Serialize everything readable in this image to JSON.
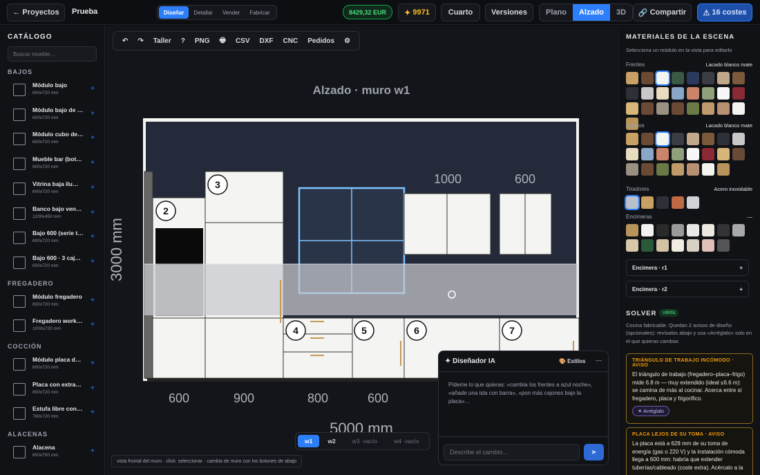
{
  "topbar": {
    "back": "← Proyectos",
    "project": "Prueba",
    "modes": [
      "Diseñar",
      "Detallar",
      "Vender",
      "Fabricar"
    ],
    "price": "8429,32 EUR",
    "credits": "9971",
    "room": "Cuarto",
    "versions": "Versiones",
    "views": [
      "Plano",
      "Alzado",
      "3D"
    ],
    "share": "Compartir",
    "costs": "16 costes"
  },
  "catalog": {
    "title": "CATÁLOGO",
    "search_placeholder": "Buscar mueble…",
    "groups": [
      {
        "name": "BAJOS",
        "items": [
          {
            "name": "Módulo bajo",
            "size": "600x720 mm"
          },
          {
            "name": "Módulo bajo de …",
            "size": "600x720 mm"
          },
          {
            "name": "Módulo cubo de…",
            "size": "600x720 mm"
          },
          {
            "name": "Mueble bar (bot…",
            "size": "600x720 mm"
          },
          {
            "name": "Vitrina baja ilu…",
            "size": "600x720 mm"
          },
          {
            "name": "Banco bajo ven…",
            "size": "1200x450 mm"
          },
          {
            "name": "Bajo 600 (serie t…",
            "size": "600x720 mm"
          },
          {
            "name": "Bajo 600 · 3 caj…",
            "size": "600x720 mm"
          }
        ]
      },
      {
        "name": "FREGADERO",
        "items": [
          {
            "name": "Módulo fregadero",
            "size": "800x720 mm"
          },
          {
            "name": "Fregadero work…",
            "size": "1000x720 mm"
          }
        ]
      },
      {
        "name": "COCCIÓN",
        "items": [
          {
            "name": "Módulo placa d…",
            "size": "600x720 mm"
          },
          {
            "name": "Placa con extra…",
            "size": "800x720 mm"
          },
          {
            "name": "Estufa libre con…",
            "size": "760x720 mm"
          }
        ]
      },
      {
        "name": "ALACENAS",
        "items": [
          {
            "name": "Alacena",
            "size": "600x700 mm"
          }
        ]
      }
    ]
  },
  "toolbar": [
    "↶",
    "↷",
    "Taller",
    "?",
    "PNG",
    "🖶",
    "CSV",
    "DXF",
    "CNC",
    "Pedidos",
    "⚙"
  ],
  "canvas": {
    "title": "Alzado · muro w1",
    "height_label": "3000 mm",
    "width_label": "5000 mm",
    "top_dims": [
      "1000",
      "600"
    ],
    "bottom_dims": [
      "600",
      "900",
      "800",
      "600"
    ],
    "markers": [
      "2",
      "3",
      "4",
      "5",
      "6",
      "7"
    ]
  },
  "walls": [
    {
      "label": "w1"
    },
    {
      "label": "w2"
    },
    {
      "label": "w3 ·vacío"
    },
    {
      "label": "w4 ·vacío"
    }
  ],
  "hint": "vista frontal del muro · click: seleccionar · cambia de muro con los botones de abajo",
  "ai": {
    "title": "✦ Diseñador IA",
    "styles": "🎨 Estilos",
    "minimize": "—",
    "intro": "Pídeme lo que quieras: «cambia los frentes a azul noche», «añade una isla con barra», «pon más cajones bajo la placa»…",
    "placeholder": "Describe el cambio…",
    "send": "➤"
  },
  "materials": {
    "title": "MATERIALES DE LA ESCENA",
    "hint": "Selecciona un módulo en la vista para editarlo",
    "frentes": {
      "label": "Frentes",
      "value": "Lacado blanco mate",
      "colors": [
        "#c9a063",
        "#6a4a35",
        "#f4f4f2",
        "#3a5a45",
        "#2b3a5c",
        "#3a3d42",
        "#c2a88a",
        "#7a5a3a",
        "#2d3038",
        "#c8c8c8",
        "#e8dcc0",
        "#8aa6c6",
        "#c9846a",
        "#8fa07a",
        "#f7f7f7",
        "#8a2a35",
        "#d8b67a",
        "#6a4a35",
        "#9a9182",
        "#6b4a35",
        "#6b7a45",
        "#c19a6b",
        "#b89072",
        "#f4f4f0",
        "#b8945a"
      ]
    },
    "cascos": {
      "label": "Cascos",
      "value": "Lacado blanco mate",
      "colors": [
        "#c9a063",
        "#6a4a35",
        "#f4f4f2",
        "#3a3d42",
        "#c2a88a",
        "#7a5a3a",
        "#2d3038",
        "#c8c8c8",
        "#e8dcc0",
        "#8aa6c6",
        "#c9846a",
        "#8fa07a",
        "#f7f7f7",
        "#8a2a35",
        "#d8b67a",
        "#6a4a35",
        "#9a9182",
        "#6b4a35",
        "#6b7a45",
        "#c19a6b",
        "#b89072",
        "#f4f4f0",
        "#b8945a"
      ]
    },
    "tiradores": {
      "label": "Tiradores",
      "value": "Acero inoxidable",
      "colors": [
        "#b8c0cc",
        "#c9a063",
        "#2d3038",
        "#c06a45",
        "#cfd3d8"
      ]
    },
    "encimeras": {
      "label": "Encimeras",
      "value": "—",
      "colors": [
        "#b8945a",
        "#f2f2f0",
        "#2a2a2a",
        "#9a9a9a",
        "#e8e8e6",
        "#ede9e1",
        "#333336",
        "#a8a8aa",
        "#d8c8a8",
        "#2a5a3a",
        "#d4c2a4",
        "#f0ece2",
        "#d8d0c2",
        "#e0c0b8",
        "#555558"
      ]
    },
    "rows": [
      {
        "label": "Encimera · r1"
      },
      {
        "label": "Encimera · r2"
      }
    ]
  },
  "solver": {
    "title": "SOLVER",
    "badge": "válida",
    "text": "Cocina fabricable. Quedan 2 avisos de diseño (opcionales): revísalos abajo y usa «Arréglalo» solo en el que quieras cambiar.",
    "warnings": [
      {
        "title": "TRIÁNGULO DE TRABAJO INCÓMODO · AVISO",
        "body": "El triángulo de trabajo (fregadero–placa–frigo) mide 6.8 m — muy extendido (ideal ≤6.6 m): se camina de más al cocinar. Acerca entre sí fregadero, placa y frigorífico.",
        "fix": "✦ Arréglalo"
      },
      {
        "title": "PLACA LEJOS DE SU TOMA · AVISO",
        "body": "La placa está a 628 mm de su toma de energía (gas o 220 V) y la instalación cómoda llega a 600 mm: habría que extender tuberías/cableado (coste extra). Acércalo a la"
      }
    ]
  }
}
